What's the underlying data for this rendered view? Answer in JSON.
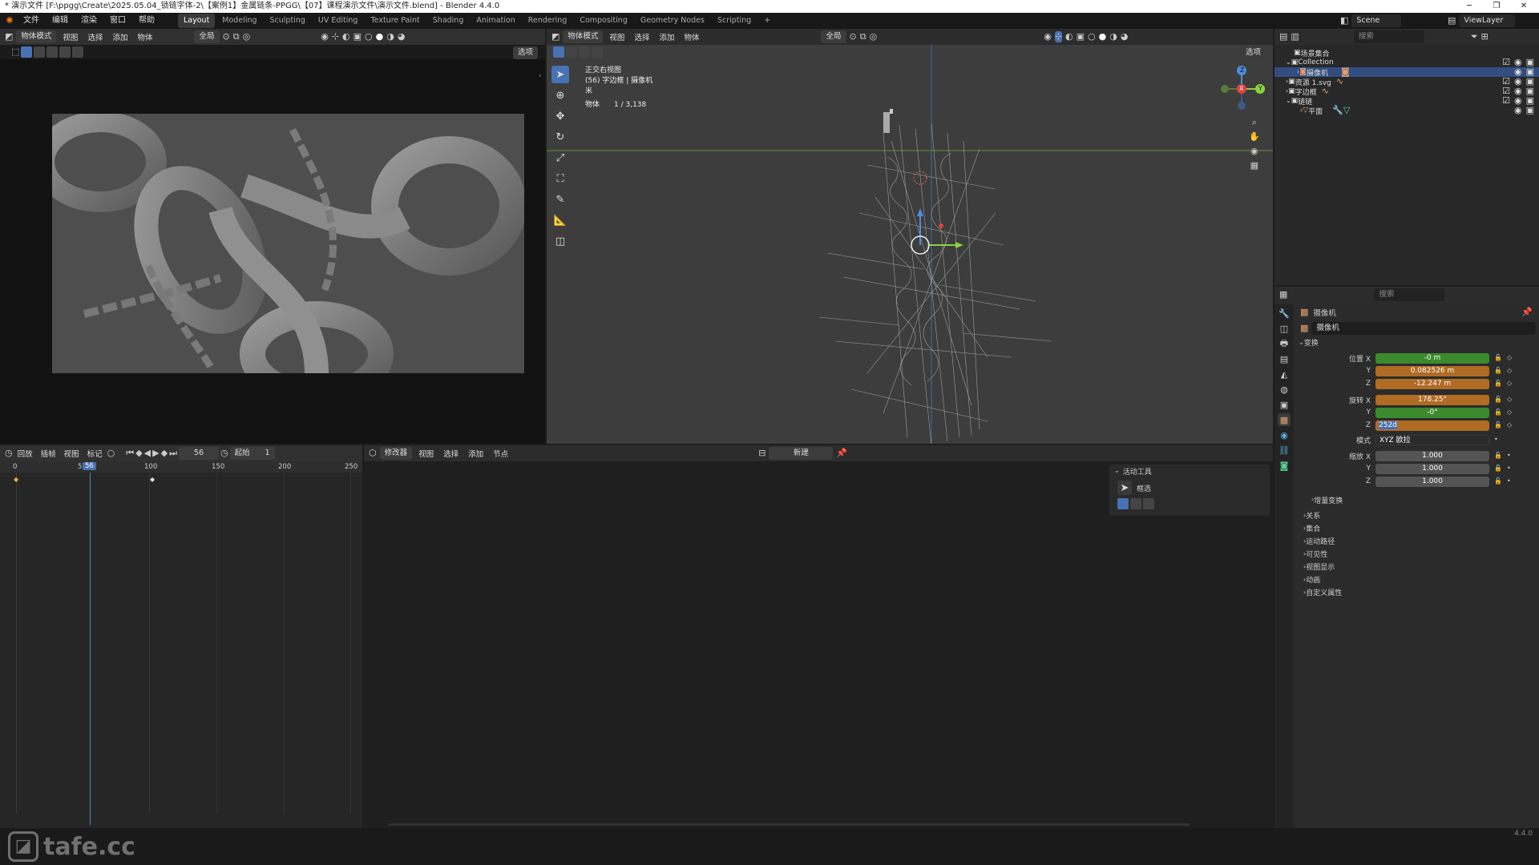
{
  "window": {
    "title": "* 演示文件 [F:\\ppgg\\Create\\2025.05.04_锁链字体-2\\【案例1】金属链条-PPGG\\【07】课程演示文件\\演示文件.blend] - Blender 4.4.0",
    "minimize": "─",
    "maximize": "❐",
    "close": "✕"
  },
  "menubar": {
    "menus": [
      "文件",
      "编辑",
      "渲染",
      "窗口",
      "帮助"
    ],
    "workspaces": [
      "Layout",
      "Modeling",
      "Sculpting",
      "UV Editing",
      "Texture Paint",
      "Shading",
      "Animation",
      "Rendering",
      "Compositing",
      "Geometry Nodes",
      "Scripting"
    ],
    "add_tab": "+",
    "scene_label": "Scene",
    "viewlayer_label": "ViewLayer"
  },
  "camera_view": {
    "mode": "物体模式",
    "menus": [
      "视图",
      "选择",
      "添加",
      "物体"
    ],
    "transform_orientation": "全局",
    "options_label": "选项"
  },
  "viewport": {
    "mode": "物体模式",
    "menus": [
      "视图",
      "选择",
      "添加",
      "物体"
    ],
    "orientation": "全局",
    "options_label": "选项",
    "overlay_line1": "正交右视图",
    "overlay_line2": "(56) 字边框 | 摄像机",
    "overlay_line3": "米",
    "stats_label": "物体",
    "stats_value": "1 / 3,138",
    "gizmo_x": "X",
    "gizmo_y": "Y",
    "gizmo_z": "Z"
  },
  "timeline": {
    "menus": [
      "回放",
      "插帧",
      "视图",
      "标记"
    ],
    "current_frame": "56",
    "start_label": "起始",
    "start_value": "1",
    "ticks": [
      "0",
      "50",
      "100",
      "150",
      "200",
      "250"
    ],
    "playhead_label": "56"
  },
  "editor2": {
    "mode": "修改器",
    "menus": [
      "视图",
      "选择",
      "添加",
      "节点"
    ],
    "new_label": "新建"
  },
  "active_tool_panel": {
    "title": "活动工具",
    "tool_name": "框选"
  },
  "outliner": {
    "search_placeholder": "搜索",
    "rows": [
      {
        "label": "场景集合",
        "indent": 0
      },
      {
        "label": "Collection",
        "indent": 1
      },
      {
        "label": "摄像机",
        "indent": 2,
        "selected": true
      },
      {
        "label": "资源 1.svg",
        "indent": 1
      },
      {
        "label": "字边框",
        "indent": 1
      },
      {
        "label": "链链",
        "indent": 1
      },
      {
        "label": "平面",
        "indent": 2
      }
    ]
  },
  "properties": {
    "search_placeholder": "搜索",
    "object_name": "摄像机",
    "object_name_field": "摄像机",
    "transform_section": "变换",
    "location_label": "位置 X",
    "loc_x": "-0 m",
    "loc_y": "0.082526 m",
    "loc_z": "-12.247 m",
    "rotation_label": "旋转 X",
    "rot_x": "178.25°",
    "rot_y": "-0°",
    "rot_z": "252d",
    "mode_label": "模式",
    "mode_value": "XYZ 欧拉",
    "scale_label": "缩放 X",
    "scale_x": "1.000",
    "scale_y": "1.000",
    "scale_z": "1.000",
    "y_label": "Y",
    "z_label": "Z",
    "delta_section": "增量变换",
    "sections": [
      "关系",
      "集合",
      "运动路径",
      "可见性",
      "视图显示",
      "动画",
      "自定义属性"
    ]
  },
  "statusbar": {
    "watermark": "tafe.cc",
    "version": "4.4.0"
  },
  "colors": {
    "accent_blue": "#4772b3",
    "green_field": "#3c8a2e",
    "orange_field": "#b06b24",
    "panel_bg": "#303030"
  }
}
